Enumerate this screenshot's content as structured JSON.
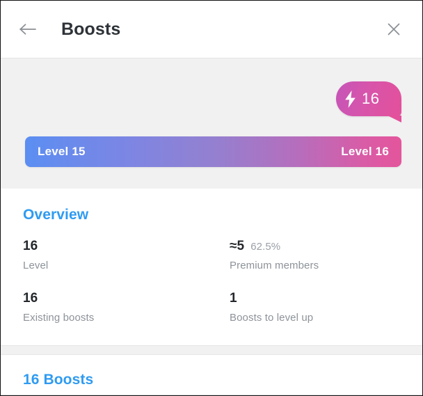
{
  "header": {
    "title": "Boosts",
    "back_icon": "arrow-left-icon",
    "close_icon": "close-icon"
  },
  "hero": {
    "badge": {
      "icon": "lightning-bolt-icon",
      "count": "16"
    },
    "progress": {
      "current_level_label": "Level 15",
      "next_level_label": "Level 16",
      "gradient_start": "#5b8ef2",
      "gradient_mid": "#9480d0",
      "gradient_end": "#e4559c"
    }
  },
  "overview": {
    "heading": "Overview",
    "accent_color": "#2f9bf1",
    "stats": [
      {
        "value": "16",
        "sub": "",
        "label": "Level"
      },
      {
        "value": "≈5",
        "sub": "62.5%",
        "label": "Premium members"
      },
      {
        "value": "16",
        "sub": "",
        "label": "Existing boosts"
      },
      {
        "value": "1",
        "sub": "",
        "label": "Boosts to level up"
      }
    ]
  },
  "boosts_section": {
    "heading": "16 Boosts"
  }
}
